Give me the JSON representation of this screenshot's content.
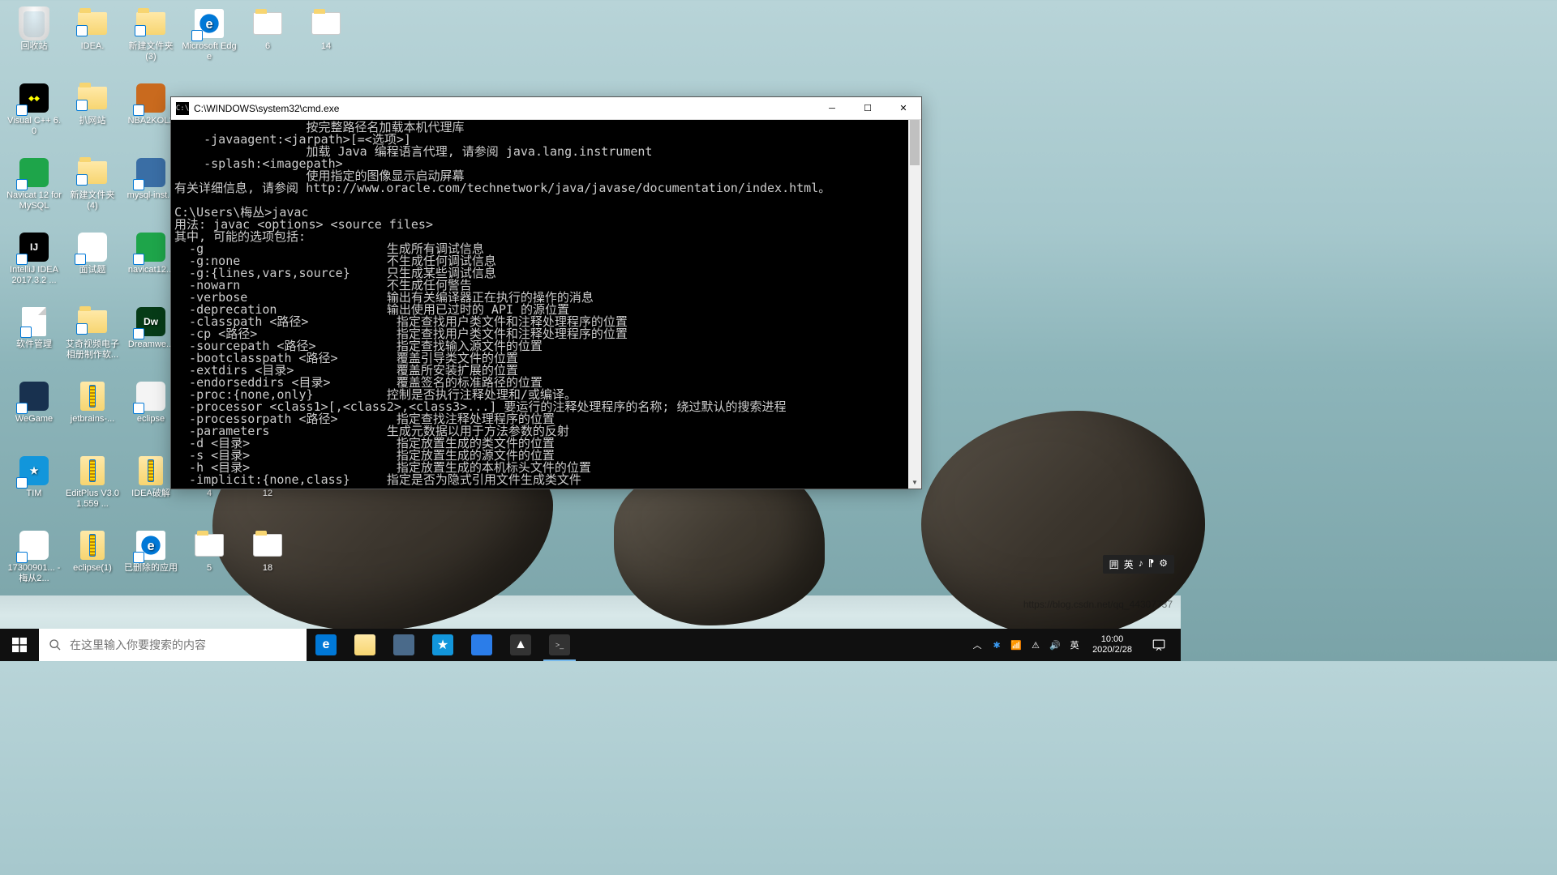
{
  "desktop": {
    "icons": [
      {
        "label": "回收站",
        "type": "recycle"
      },
      {
        "label": "IDEA.",
        "type": "folder"
      },
      {
        "label": "新建文件夹 (3)",
        "type": "folder"
      },
      {
        "label": "Microsoft Edge",
        "type": "edge"
      },
      {
        "label": "6",
        "type": "paper-folder"
      },
      {
        "label": "14",
        "type": "paper-folder"
      },
      {
        "label": "Visual C++ 6.0",
        "type": "vc",
        "bg": "#000"
      },
      {
        "label": "扒网站",
        "type": "folder"
      },
      {
        "label": "NBA2KOL2",
        "type": "app",
        "bg": "#c96a1e"
      },
      {
        "label": "",
        "type": "empty"
      },
      {
        "label": "",
        "type": "empty"
      },
      {
        "label": "",
        "type": "empty"
      },
      {
        "label": "Navicat 12 for MySQL",
        "type": "app",
        "bg": "#1ea54a"
      },
      {
        "label": "新建文件夹 (4)",
        "type": "folder"
      },
      {
        "label": "mysql-inst...",
        "type": "app",
        "bg": "#3a6ea5"
      },
      {
        "label": "",
        "type": "empty"
      },
      {
        "label": "",
        "type": "empty"
      },
      {
        "label": "",
        "type": "empty"
      },
      {
        "label": "IntelliJ IDEA 2017.3.2 ...",
        "type": "app",
        "bg": "#000",
        "fg": "IJ"
      },
      {
        "label": "面试题",
        "type": "app",
        "bg": "#fff"
      },
      {
        "label": "navicat12...",
        "type": "app",
        "bg": "#1ea54a"
      },
      {
        "label": "",
        "type": "empty"
      },
      {
        "label": "",
        "type": "empty"
      },
      {
        "label": "",
        "type": "empty"
      },
      {
        "label": "软件管理",
        "type": "paper"
      },
      {
        "label": "艾奇视频电子相册制作软...",
        "type": "folder"
      },
      {
        "label": "Dreamwe...",
        "type": "app",
        "bg": "#063b17",
        "fg": "Dw"
      },
      {
        "label": "",
        "type": "empty"
      },
      {
        "label": "",
        "type": "empty"
      },
      {
        "label": "",
        "type": "empty"
      },
      {
        "label": "WeGame",
        "type": "app",
        "bg": "#18314f"
      },
      {
        "label": "jetbrains-...",
        "type": "zip"
      },
      {
        "label": "eclipse",
        "type": "app",
        "bg": "#f4f4f4"
      },
      {
        "label": "",
        "type": "empty"
      },
      {
        "label": "",
        "type": "empty"
      },
      {
        "label": "",
        "type": "empty"
      },
      {
        "label": "TIM",
        "type": "app",
        "bg": "#1296db",
        "fg": "★"
      },
      {
        "label": "EditPlus V3.01.559 ...",
        "type": "zip"
      },
      {
        "label": "IDEA破解",
        "type": "zip"
      },
      {
        "label": "4",
        "type": "zip"
      },
      {
        "label": "12",
        "type": "zip"
      },
      {
        "label": "",
        "type": "empty"
      },
      {
        "label": "17300901... - 梅从2...",
        "type": "app",
        "bg": "#fff"
      },
      {
        "label": "eclipse(1)",
        "type": "zip"
      },
      {
        "label": "已删除的应用",
        "type": "edge"
      },
      {
        "label": "5",
        "type": "paper-folder"
      },
      {
        "label": "18",
        "type": "paper-folder"
      }
    ]
  },
  "cmd": {
    "title": "C:\\WINDOWS\\system32\\cmd.exe",
    "lines": [
      "                  按完整路径名加载本机代理库",
      "    -javaagent:<jarpath>[=<选项>]",
      "                  加载 Java 编程语言代理, 请参阅 java.lang.instrument",
      "    -splash:<imagepath>",
      "                  使用指定的图像显示启动屏幕",
      "有关详细信息, 请参阅 http://www.oracle.com/technetwork/java/javase/documentation/index.html。",
      "",
      "C:\\Users\\梅丛>javac",
      "用法: javac <options> <source files>",
      "其中, 可能的选项包括:",
      "  -g                         生成所有调试信息",
      "  -g:none                    不生成任何调试信息",
      "  -g:{lines,vars,source}     只生成某些调试信息",
      "  -nowarn                    不生成任何警告",
      "  -verbose                   输出有关编译器正在执行的操作的消息",
      "  -deprecation               输出使用已过时的 API 的源位置",
      "  -classpath <路径>            指定查找用户类文件和注释处理程序的位置",
      "  -cp <路径>                   指定查找用户类文件和注释处理程序的位置",
      "  -sourcepath <路径>           指定查找输入源文件的位置",
      "  -bootclasspath <路径>        覆盖引导类文件的位置",
      "  -extdirs <目录>              覆盖所安装扩展的位置",
      "  -endorseddirs <目录>         覆盖签名的标准路径的位置",
      "  -proc:{none,only}          控制是否执行注释处理和/或编译。",
      "  -processor <class1>[,<class2>,<class3>...] 要运行的注释处理程序的名称; 绕过默认的搜索进程",
      "  -processorpath <路径>        指定查找注释处理程序的位置",
      "  -parameters                生成元数据以用于方法参数的反射",
      "  -d <目录>                    指定放置生成的类文件的位置",
      "  -s <目录>                    指定放置生成的源文件的位置",
      "  -h <目录>                    指定放置生成的本机标头文件的位置",
      "  -implicit:{none,class}     指定是否为隐式引用文件生成类文件"
    ]
  },
  "ime": {
    "items": [
      "囲",
      "英",
      "♪",
      "⁋",
      "⚙"
    ]
  },
  "taskbar": {
    "search_placeholder": "在这里输入你要搜索的内容",
    "time": "10:00",
    "date": "2020/2/28",
    "lang": "英"
  },
  "watermark": {
    "l1": "https://blog.csdn.net/qq_44307737"
  }
}
